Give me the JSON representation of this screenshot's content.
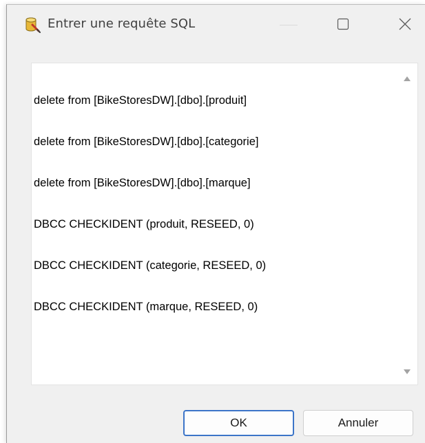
{
  "window": {
    "title": "Entrer une requête SQL"
  },
  "editor": {
    "lines": [
      "delete from [BikeStoresDW].[dbo].[produit]",
      "delete from [BikeStoresDW].[dbo].[categorie]",
      "delete from [BikeStoresDW].[dbo].[marque]",
      "DBCC CHECKIDENT (produit, RESEED, 0)",
      "DBCC CHECKIDENT (categorie, RESEED, 0)",
      "DBCC CHECKIDENT (marque, RESEED, 0)"
    ]
  },
  "buttons": {
    "ok_label": "OK",
    "cancel_label": "Annuler"
  },
  "icons": {
    "app": "database-icon",
    "maximize": "maximize-icon",
    "close": "close-icon",
    "scroll_up": "scroll-up-arrow-icon",
    "scroll_down": "scroll-down-arrow-icon"
  },
  "colors": {
    "ok_border": "#3b74c8",
    "window_bg": "#f0f0f0"
  }
}
